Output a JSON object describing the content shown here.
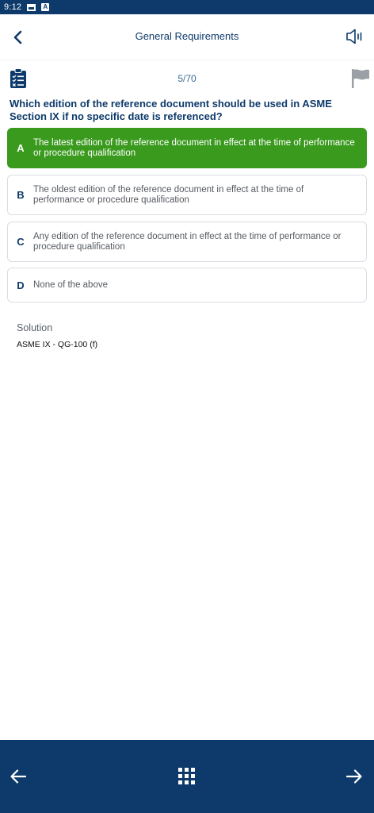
{
  "status_bar": {
    "time": "9:12",
    "icons": [
      "image-icon",
      "a-badge-icon"
    ],
    "badge_letter": "A"
  },
  "header": {
    "title": "General Requirements",
    "icons": [
      "chevron-left-icon",
      "speaker-icon"
    ]
  },
  "quiz": {
    "progress": "5/70",
    "current": 5,
    "total": 70,
    "icons": [
      "clipboard-checklist-icon",
      "flag-icon"
    ],
    "question": "Which edition of the reference document should be used in ASME Section IX if no specific date is referenced?",
    "options": [
      {
        "letter": "A",
        "text": "The latest edition of the reference document in effect at the time of performance or procedure qualification",
        "selected": true
      },
      {
        "letter": "B",
        "text": "The oldest edition of the reference document in effect at the time of performance or procedure qualification",
        "selected": false
      },
      {
        "letter": "C",
        "text": "Any edition of the reference document in effect at the time of performance or procedure qualification",
        "selected": false
      },
      {
        "letter": "D",
        "text": "None of the above",
        "selected": false
      }
    ]
  },
  "solution": {
    "label": "Solution",
    "text": "ASME IX - QG-100 (f)"
  },
  "bottom_nav": {
    "icons": [
      "arrow-left-icon",
      "grid-icon",
      "arrow-right-icon"
    ]
  },
  "colors": {
    "primary": "#0d3a6a",
    "selected": "#3a9a1e",
    "border": "#d9dde3",
    "flag": "#9aa0a6"
  }
}
